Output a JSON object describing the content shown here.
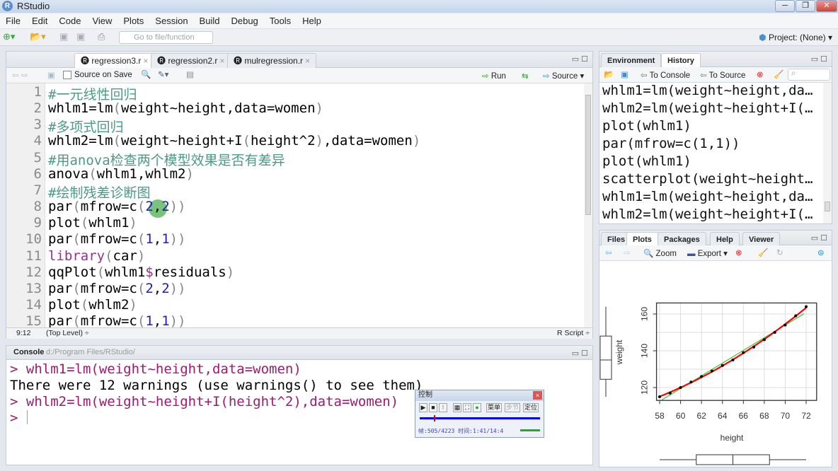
{
  "window": {
    "title": "RStudio",
    "controls": [
      "minimize",
      "restore",
      "close"
    ]
  },
  "menu": [
    "File",
    "Edit",
    "Code",
    "View",
    "Plots",
    "Session",
    "Build",
    "Debug",
    "Tools",
    "Help"
  ],
  "toolbar": {
    "goto_placeholder": "Go to file/function",
    "project": "Project: (None)"
  },
  "editor": {
    "tabs": [
      {
        "label": "regression3.r",
        "active": true
      },
      {
        "label": "regression2.r"
      },
      {
        "label": "mulregression.r"
      }
    ],
    "source_on_save": "Source on Save",
    "run": "Run",
    "source": "Source",
    "lines": [
      [
        [
          "c",
          "#一元线性回归"
        ]
      ],
      [
        [
          "d",
          "whlm1=lm"
        ],
        [
          "p",
          "("
        ],
        [
          "d",
          "weight~height,data=women"
        ],
        [
          "p",
          ")"
        ]
      ],
      [
        [
          "c",
          "#多项式回归"
        ]
      ],
      [
        [
          "d",
          "whlm2=lm"
        ],
        [
          "p",
          "("
        ],
        [
          "d",
          "weight~height+I"
        ],
        [
          "p",
          "("
        ],
        [
          "d",
          "height^2"
        ],
        [
          "p",
          ")"
        ],
        [
          "d",
          ",data=women"
        ],
        [
          "p",
          ")"
        ]
      ],
      [
        [
          "c",
          "#用anova检查两个模型效果是否有差异"
        ]
      ],
      [
        [
          "d",
          "anova"
        ],
        [
          "p",
          "("
        ],
        [
          "d",
          "whlm1,whlm2"
        ],
        [
          "p",
          ")"
        ]
      ],
      [
        [
          "c",
          "#绘制残差诊断图"
        ]
      ],
      [
        [
          "d",
          "par"
        ],
        [
          "p",
          "("
        ],
        [
          "d",
          "mfrow=c"
        ],
        [
          "p",
          "("
        ],
        [
          "n",
          "2"
        ],
        [
          "d",
          ","
        ],
        [
          "n",
          "2"
        ],
        [
          "p",
          "))"
        ]
      ],
      [
        [
          "d",
          "plot"
        ],
        [
          "p",
          "("
        ],
        [
          "d",
          "whlm1"
        ],
        [
          "p",
          ")"
        ]
      ],
      [
        [
          "d",
          "par"
        ],
        [
          "p",
          "("
        ],
        [
          "d",
          "mfrow=c"
        ],
        [
          "p",
          "("
        ],
        [
          "n",
          "1"
        ],
        [
          "d",
          ","
        ],
        [
          "n",
          "1"
        ],
        [
          "p",
          "))"
        ]
      ],
      [
        [
          "f",
          "library"
        ],
        [
          "p",
          "("
        ],
        [
          "d",
          "car"
        ],
        [
          "p",
          ")"
        ]
      ],
      [
        [
          "d",
          "qqPlot"
        ],
        [
          "p",
          "("
        ],
        [
          "d",
          "whlm1"
        ],
        [
          "f",
          "$"
        ],
        [
          "d",
          "residuals"
        ],
        [
          "p",
          ")"
        ]
      ],
      [
        [
          "d",
          "par"
        ],
        [
          "p",
          "("
        ],
        [
          "d",
          "mfrow=c"
        ],
        [
          "p",
          "("
        ],
        [
          "n",
          "2"
        ],
        [
          "d",
          ","
        ],
        [
          "n",
          "2"
        ],
        [
          "p",
          "))"
        ]
      ],
      [
        [
          "d",
          "plot"
        ],
        [
          "p",
          "("
        ],
        [
          "d",
          "whlm2"
        ],
        [
          "p",
          ")"
        ]
      ],
      [
        [
          "d",
          "par"
        ],
        [
          "p",
          "("
        ],
        [
          "d",
          "mfrow=c"
        ],
        [
          "p",
          "("
        ],
        [
          "n",
          "1"
        ],
        [
          "d",
          ","
        ],
        [
          "n",
          "1"
        ],
        [
          "p",
          "))"
        ]
      ]
    ],
    "status": {
      "position": "9:12",
      "scope": "(Top Level) ÷",
      "filetype": "R Script ÷"
    }
  },
  "console": {
    "title": "Console",
    "path": "d:/Program Files/RStudio/",
    "lines": [
      {
        "type": "in",
        "text": "> whlm1=lm(weight~height,data=women)"
      },
      {
        "type": "out",
        "text": "There were 12 warnings (use warnings() to see them)"
      },
      {
        "type": "in",
        "text": "> whlm2=lm(weight~height+I(height^2),data=women)"
      },
      {
        "type": "in",
        "text": "> "
      }
    ]
  },
  "env": {
    "tabs": [
      "Environment",
      "History"
    ],
    "active": "History",
    "to_console": "To Console",
    "to_source": "To Source",
    "history": [
      "whlm1=lm(weight~height,da…",
      "whlm2=lm(weight~height+I(…",
      "plot(whlm1)",
      "par(mfrow=c(1,1))",
      "plot(whlm1)",
      "scatterplot(weight~height…",
      "whlm1=lm(weight~height,da…",
      "whlm2=lm(weight~height+I(…"
    ]
  },
  "files": {
    "tabs": [
      "Files",
      "Plots",
      "Packages",
      "Help",
      "Viewer"
    ],
    "active": "Plots",
    "zoom": "Zoom",
    "export": "Export ▾"
  },
  "chart_data": {
    "type": "scatter",
    "xlabel": "height",
    "ylabel": "weight",
    "x": [
      58,
      59,
      60,
      61,
      62,
      63,
      64,
      65,
      66,
      67,
      68,
      69,
      70,
      71,
      72
    ],
    "y": [
      115,
      117,
      120,
      123,
      126,
      129,
      132,
      135,
      139,
      142,
      146,
      150,
      154,
      159,
      164
    ],
    "xticks": [
      58,
      60,
      62,
      64,
      66,
      68,
      70,
      72
    ],
    "yticks": [
      120,
      140,
      160
    ],
    "xlim": [
      57.7,
      73
    ],
    "ylim": [
      113,
      166
    ],
    "grid": true,
    "lines": [
      {
        "kind": "linear fit",
        "color": "#33cc33"
      },
      {
        "kind": "smooth fit",
        "color": "#ff0000"
      }
    ],
    "marginal_boxplots": true
  },
  "player": {
    "title": "控制",
    "menu": "菜单",
    "step": "步节",
    "locate": "定位",
    "status": "帧:505/4223 时间:1:41/14:4",
    "progress": 0.12
  },
  "colors": {
    "comment": "#4c9a84",
    "number": "#1c1cbf",
    "console_input": "#9b1c6c"
  }
}
